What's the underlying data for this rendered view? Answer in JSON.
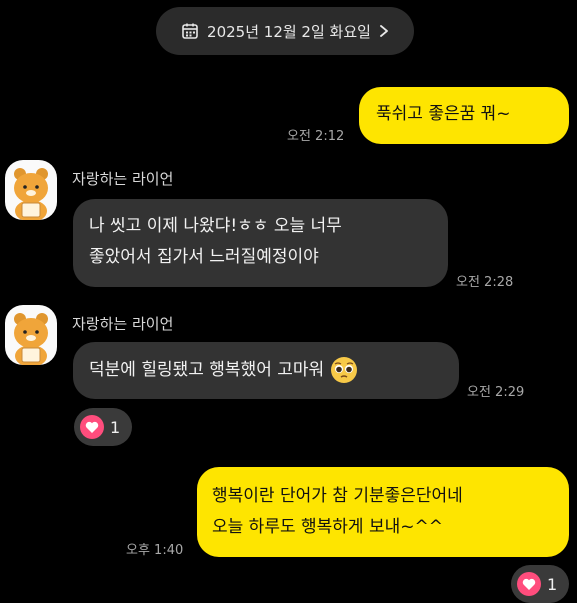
{
  "date_bar": {
    "label": "2025년 12월 2일 화요일",
    "calendar_icon": "calendar-icon",
    "chevron_icon": "chevron-right-icon"
  },
  "messages": [
    {
      "from": "me",
      "text": "푹쉬고 좋은꿈 꿔~",
      "time": "오전 2:12"
    },
    {
      "from": "other",
      "sender": "자랑하는 라이언",
      "lines": [
        "나 씻고 이제 나왔댜!ㅎㅎ 오늘 너무",
        "좋았어서 집가서 느러질예정이야"
      ],
      "time": "오전 2:28"
    },
    {
      "from": "other",
      "sender": "자랑하는 라이언",
      "lines": [
        "덕분에 힐링됐고 행복했어 고마워"
      ],
      "emoji": "pleading-face-emoji",
      "time": "오전 2:29",
      "reaction": {
        "icon": "heart-icon",
        "count": "1"
      }
    },
    {
      "from": "me",
      "lines": [
        "행복이란 단어가 참 기분좋은단어네",
        "오늘 하루도 행복하게 보내~^^"
      ],
      "time": "오후 1:40",
      "reaction": {
        "icon": "heart-icon",
        "count": "1"
      }
    }
  ],
  "colors": {
    "background": "#000000",
    "my_bubble": "#fee500",
    "other_bubble": "#333333",
    "heart": "#ff4d7d"
  }
}
